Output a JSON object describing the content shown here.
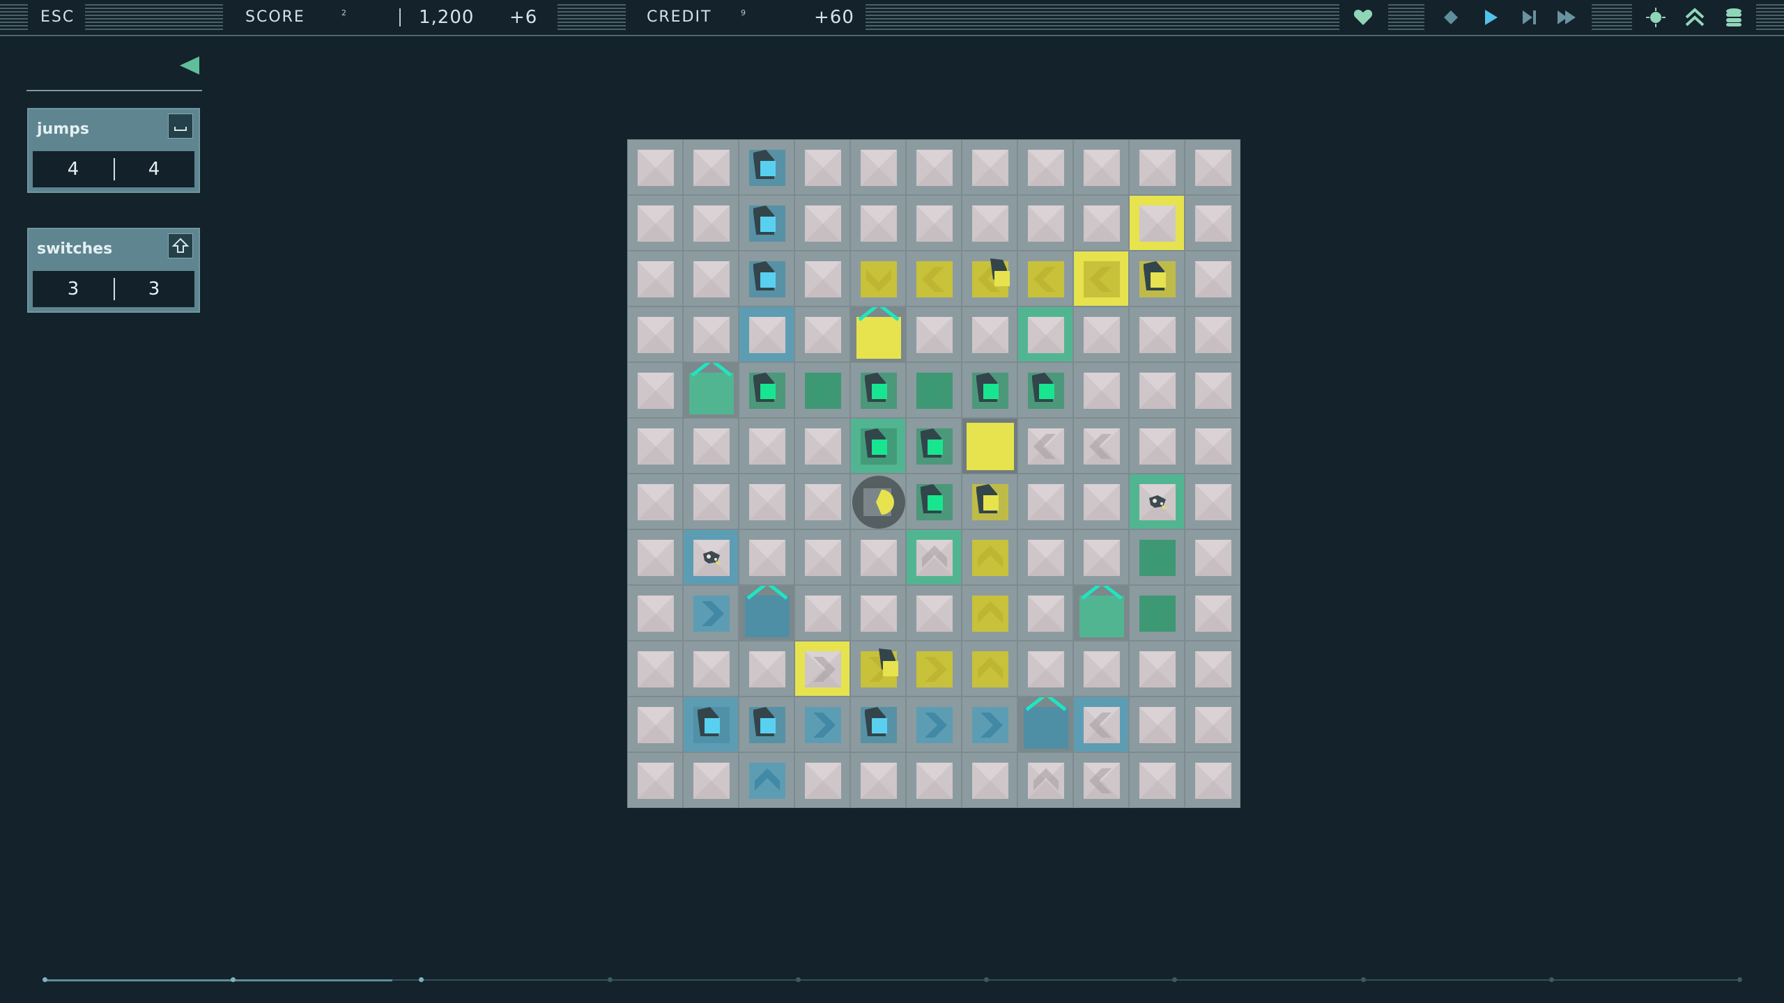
{
  "topbar": {
    "esc_label": "ESC",
    "score_label": "SCORE",
    "score_superscript": "2",
    "score_value": "1,200",
    "score_delta": "+6",
    "credit_label": "CREDIT",
    "credit_superscript": "9",
    "credit_delta": "+60",
    "icons": [
      "heart-icon",
      "diamond-icon",
      "play-icon",
      "step-icon",
      "fast-forward-icon",
      "sun-icon",
      "double-chevron-up-icon",
      "stack-icon"
    ]
  },
  "counters": [
    {
      "title": "jumps",
      "key_icon": "space-key-icon",
      "left": "4",
      "right": "4"
    },
    {
      "title": "switches",
      "key_icon": "shift-key-icon",
      "left": "3",
      "right": "3"
    }
  ],
  "colors": {
    "background": "#14222b",
    "board": "#8c9ba0",
    "tile_light": "#cfc6c9",
    "cyan": "#5ad0f0",
    "blue_zone": "#5d9db3",
    "teal_zone": "#52b591",
    "yellow": "#e6e34e",
    "green": "#18e58f",
    "accent": "#5fbf9a"
  },
  "board": {
    "cols": 11,
    "rows": 12,
    "cells": [
      {
        "r": 0,
        "c": 2,
        "bg": "none",
        "t": "cube",
        "col": "cyan"
      },
      {
        "r": 1,
        "c": 2,
        "bg": "none",
        "t": "cube",
        "col": "cyan"
      },
      {
        "r": 1,
        "c": 9,
        "bg": "yellow",
        "t": "tile"
      },
      {
        "r": 2,
        "c": 2,
        "bg": "none",
        "t": "cube",
        "col": "cyan"
      },
      {
        "r": 2,
        "c": 4,
        "bg": "none",
        "t": "arrow",
        "col": "yellow",
        "dir": "down"
      },
      {
        "r": 2,
        "c": 5,
        "bg": "none",
        "t": "arrow",
        "col": "yellow",
        "dir": "left"
      },
      {
        "r": 2,
        "c": 6,
        "bg": "none",
        "t": "arrowcube",
        "col": "yellow",
        "dir": "left"
      },
      {
        "r": 2,
        "c": 7,
        "bg": "none",
        "t": "arrow",
        "col": "yellow",
        "dir": "left"
      },
      {
        "r": 2,
        "c": 8,
        "bg": "yellow",
        "t": "arrow",
        "col": "yellow",
        "dir": "left"
      },
      {
        "r": 2,
        "c": 9,
        "bg": "none",
        "t": "cube",
        "col": "yellow"
      },
      {
        "r": 3,
        "c": 2,
        "bg": "blue",
        "t": "tile"
      },
      {
        "r": 3,
        "c": 4,
        "bg": "none",
        "t": "house",
        "col": "yellow"
      },
      {
        "r": 3,
        "c": 7,
        "bg": "teal",
        "t": "tile"
      },
      {
        "r": 4,
        "c": 1,
        "bg": "none",
        "t": "house",
        "col": "teal"
      },
      {
        "r": 4,
        "c": 2,
        "bg": "none",
        "t": "cube",
        "col": "green"
      },
      {
        "r": 4,
        "c": 3,
        "bg": "none",
        "t": "arrow",
        "col": "teal",
        "dir": "left"
      },
      {
        "r": 4,
        "c": 4,
        "bg": "none",
        "t": "cube",
        "col": "green"
      },
      {
        "r": 4,
        "c": 5,
        "bg": "none",
        "t": "arrow",
        "col": "teal",
        "dir": "left"
      },
      {
        "r": 4,
        "c": 6,
        "bg": "none",
        "t": "cube",
        "col": "green"
      },
      {
        "r": 4,
        "c": 7,
        "bg": "none",
        "t": "cube",
        "col": "green"
      },
      {
        "r": 5,
        "c": 4,
        "bg": "teal",
        "t": "cube",
        "col": "green"
      },
      {
        "r": 5,
        "c": 5,
        "bg": "none",
        "t": "cube",
        "col": "green"
      },
      {
        "r": 5,
        "c": 6,
        "bg": "none",
        "t": "block",
        "col": "yellow"
      },
      {
        "r": 5,
        "c": 7,
        "bg": "none",
        "t": "arrowtile",
        "dir": "left"
      },
      {
        "r": 5,
        "c": 8,
        "bg": "none",
        "t": "arrowtile",
        "dir": "left"
      },
      {
        "r": 6,
        "c": 4,
        "bg": "none",
        "t": "player"
      },
      {
        "r": 6,
        "c": 5,
        "bg": "none",
        "t": "cube",
        "col": "green"
      },
      {
        "r": 6,
        "c": 6,
        "bg": "none",
        "t": "cube",
        "col": "yellow"
      },
      {
        "r": 6,
        "c": 9,
        "bg": "teal",
        "t": "creature"
      },
      {
        "r": 7,
        "c": 1,
        "bg": "blue",
        "t": "creature"
      },
      {
        "r": 7,
        "c": 5,
        "bg": "teal",
        "t": "arrowtile",
        "dir": "up"
      },
      {
        "r": 7,
        "c": 6,
        "bg": "none",
        "t": "arrow",
        "col": "yellow",
        "dir": "up"
      },
      {
        "r": 7,
        "c": 9,
        "bg": "none",
        "t": "arrow",
        "col": "teal",
        "dir": "down"
      },
      {
        "r": 8,
        "c": 1,
        "bg": "none",
        "t": "arrow",
        "col": "blue",
        "dir": "right"
      },
      {
        "r": 8,
        "c": 2,
        "bg": "none",
        "t": "house",
        "col": "blue"
      },
      {
        "r": 8,
        "c": 6,
        "bg": "none",
        "t": "arrow",
        "col": "yellow",
        "dir": "up"
      },
      {
        "r": 8,
        "c": 8,
        "bg": "none",
        "t": "house",
        "col": "teal"
      },
      {
        "r": 8,
        "c": 9,
        "bg": "none",
        "t": "arrow",
        "col": "teal",
        "dir": "left"
      },
      {
        "r": 9,
        "c": 3,
        "bg": "yellow",
        "t": "arrowtile",
        "dir": "right"
      },
      {
        "r": 9,
        "c": 4,
        "bg": "none",
        "t": "arrowcube",
        "col": "yellow",
        "dir": "right"
      },
      {
        "r": 9,
        "c": 5,
        "bg": "none",
        "t": "arrow",
        "col": "yellow",
        "dir": "right"
      },
      {
        "r": 9,
        "c": 6,
        "bg": "none",
        "t": "arrow",
        "col": "yellow",
        "dir": "up"
      },
      {
        "r": 10,
        "c": 1,
        "bg": "blue",
        "t": "cube",
        "col": "cyan"
      },
      {
        "r": 10,
        "c": 2,
        "bg": "none",
        "t": "cube",
        "col": "cyan"
      },
      {
        "r": 10,
        "c": 3,
        "bg": "none",
        "t": "arrow",
        "col": "blue",
        "dir": "right"
      },
      {
        "r": 10,
        "c": 4,
        "bg": "none",
        "t": "cube",
        "col": "cyan"
      },
      {
        "r": 10,
        "c": 5,
        "bg": "none",
        "t": "arrow",
        "col": "blue",
        "dir": "right"
      },
      {
        "r": 10,
        "c": 6,
        "bg": "none",
        "t": "arrow",
        "col": "blue",
        "dir": "right"
      },
      {
        "r": 10,
        "c": 7,
        "bg": "none",
        "t": "house",
        "col": "blue"
      },
      {
        "r": 10,
        "c": 8,
        "bg": "blue",
        "t": "arrowtile",
        "dir": "left"
      },
      {
        "r": 11,
        "c": 2,
        "bg": "none",
        "t": "arrow",
        "col": "blue",
        "dir": "up"
      },
      {
        "r": 11,
        "c": 7,
        "bg": "none",
        "t": "arrowtile",
        "dir": "up"
      },
      {
        "r": 11,
        "c": 8,
        "bg": "none",
        "t": "arrowtile",
        "dir": "left"
      }
    ]
  },
  "timeline": {
    "ticks": 10,
    "completed_ticks": 3,
    "progress": 0.2
  }
}
